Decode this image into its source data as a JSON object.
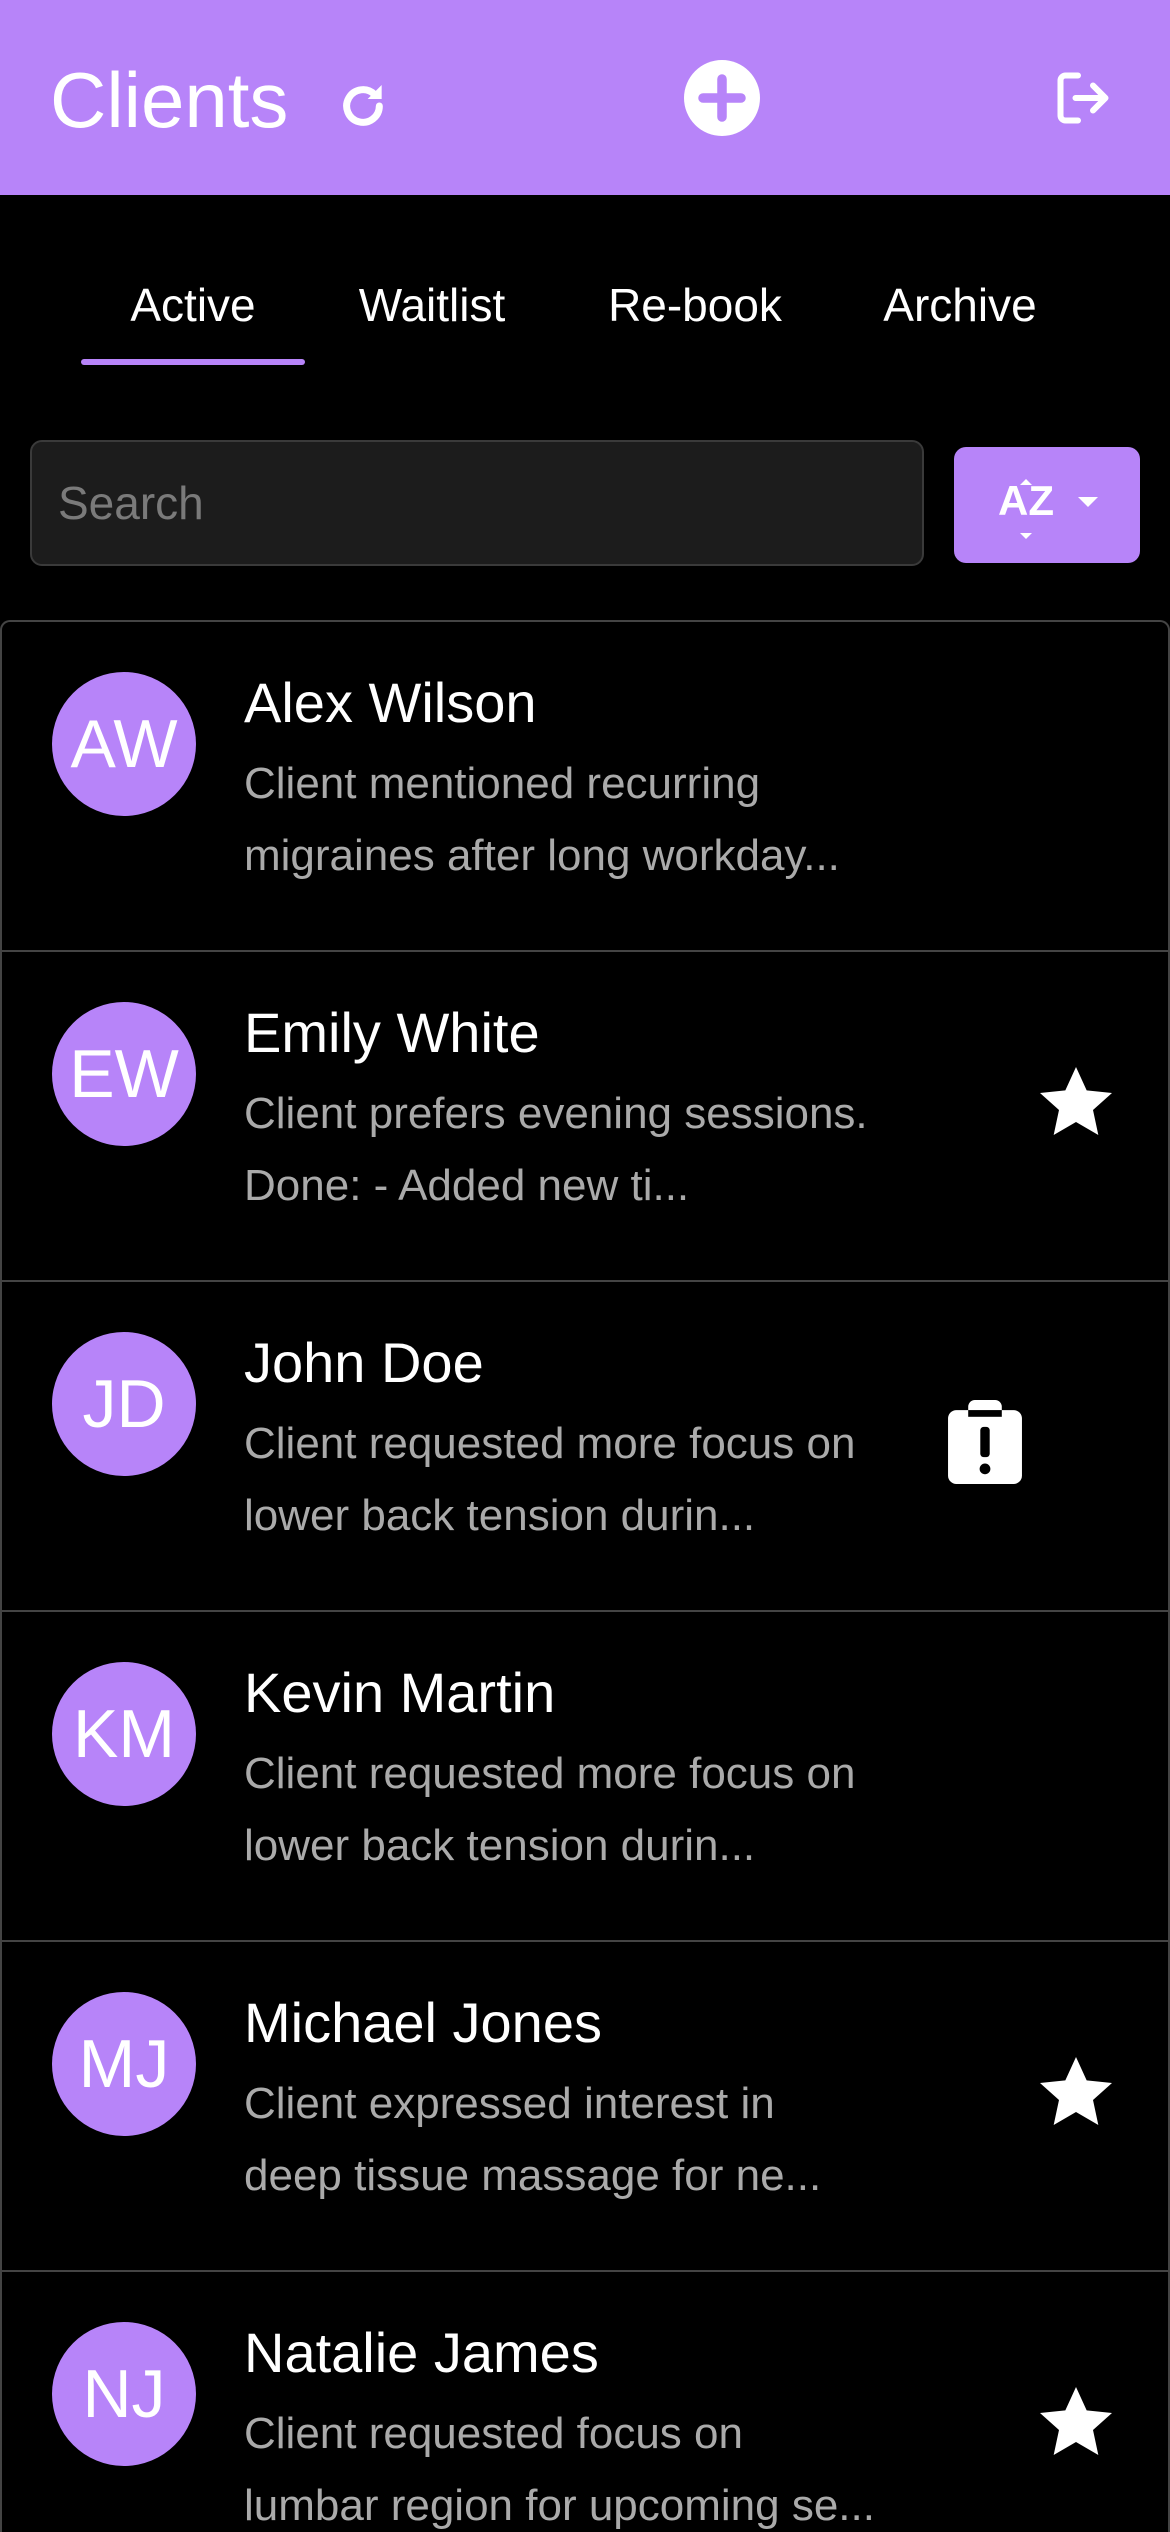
{
  "header": {
    "title": "Clients",
    "refresh_icon": "refresh-icon",
    "add_icon": "add-circle-icon",
    "logout_icon": "logout-icon",
    "background_color": "#b784f9"
  },
  "tabs": [
    {
      "label": "Active",
      "selected": true
    },
    {
      "label": "Waitlist",
      "selected": false
    },
    {
      "label": "Re-book",
      "selected": false
    },
    {
      "label": "Archive",
      "selected": false
    }
  ],
  "search": {
    "placeholder": "Search",
    "value": ""
  },
  "sort": {
    "label": "AZ",
    "icon": "sort-alpha-icon"
  },
  "clients": [
    {
      "initials": "AW",
      "name": "Alex Wilson",
      "note_line1": "Client mentioned recurring",
      "note_line2": "migraines after long workday...",
      "status_icon": "none"
    },
    {
      "initials": "EW",
      "name": "Emily White",
      "note_line1": "Client prefers evening sessions.",
      "note_line2": "Done: - Added new ti...",
      "status_icon": "star-icon"
    },
    {
      "initials": "JD",
      "name": "John Doe",
      "note_line1": "Client requested more focus on",
      "note_line2": "lower back tension durin...",
      "status_icon": "clipboard-alert-icon"
    },
    {
      "initials": "KM",
      "name": "Kevin Martin",
      "note_line1": "Client requested more focus on",
      "note_line2": "lower back tension durin...",
      "status_icon": "none"
    },
    {
      "initials": "MJ",
      "name": "Michael Jones",
      "note_line1": "Client expressed interest in",
      "note_line2": "deep tissue massage for ne...",
      "status_icon": "star-icon"
    },
    {
      "initials": "NJ",
      "name": "Natalie James",
      "note_line1": "Client requested focus on",
      "note_line2": "lumbar region for upcoming se...",
      "status_icon": "star-icon"
    }
  ],
  "colors": {
    "accent": "#b784f9",
    "background": "#000000",
    "muted_text": "#aaaaaa"
  }
}
